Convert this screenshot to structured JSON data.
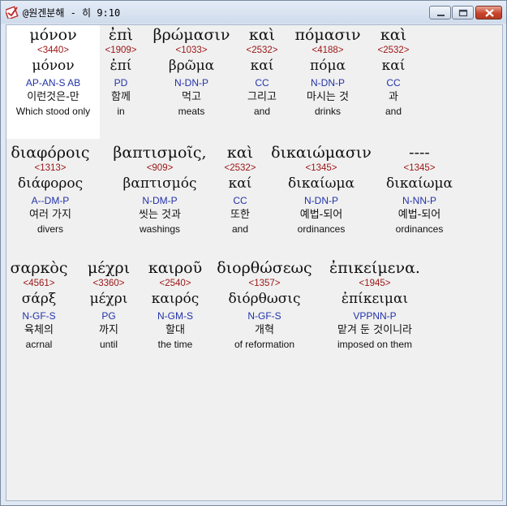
{
  "window": {
    "title": "@원겐분해 - 히 9:10"
  },
  "lines": [
    {
      "words": [
        {
          "greek": "μόνον",
          "strong": "<3440>",
          "lemma": "μόνον",
          "parse": "AP-AN-S AB",
          "korean": "이런것은-만",
          "english": "Which stood only",
          "selected": true
        },
        {
          "greek": "ἐπὶ",
          "strong": "<1909>",
          "lemma": "ἐπί",
          "parse": "PD",
          "korean": "함께",
          "english": "in"
        },
        {
          "greek": "βρώμασιν",
          "strong": "<1033>",
          "lemma": "βρῶμα",
          "parse": "N-DN-P",
          "korean": "먹고",
          "english": "meats"
        },
        {
          "greek": "καὶ",
          "strong": "<2532>",
          "lemma": "καί",
          "parse": "CC",
          "korean": "그리고",
          "english": "and"
        },
        {
          "greek": "πόμασιν",
          "strong": "<4188>",
          "lemma": "πόμα",
          "parse": "N-DN-P",
          "korean": "마시는 것",
          "english": "drinks"
        },
        {
          "greek": "καὶ",
          "strong": "<2532>",
          "lemma": "καί",
          "parse": "CC",
          "korean": "과",
          "english": "and"
        }
      ]
    },
    {
      "words": [
        {
          "greek": "διαφόροις",
          "strong": "<1313>",
          "lemma": "διάφορος",
          "parse": "A--DM-P",
          "korean": "여러 가지",
          "english": "divers"
        },
        {
          "greek": "βαπτισμοῖς,",
          "strong": "<909>",
          "lemma": "βαπτισμός",
          "parse": "N-DM-P",
          "korean": "씻는 것과",
          "english": "washings"
        },
        {
          "greek": "καὶ",
          "strong": "<2532>",
          "lemma": "καί",
          "parse": "CC",
          "korean": "또한",
          "english": "and"
        },
        {
          "greek": "δικαιώμασιν",
          "strong": "<1345>",
          "lemma": "δικαίωμα",
          "parse": "N-DN-P",
          "korean": "예법-되어",
          "english": "ordinances"
        },
        {
          "greek": "----",
          "strong": "<1345>",
          "lemma": "δικαίωμα",
          "parse": "N-NN-P",
          "korean": "예법-되어",
          "english": "ordinances"
        }
      ]
    },
    {
      "words": [
        {
          "greek": "σαρκὸς",
          "strong": "<4561>",
          "lemma": "σάρξ",
          "parse": "N-GF-S",
          "korean": "육체의",
          "english": "acrnal"
        },
        {
          "greek": "μέχρι",
          "strong": "<3360>",
          "lemma": "μέχρι",
          "parse": "PG",
          "korean": "까지",
          "english": "until"
        },
        {
          "greek": "καιροῦ",
          "strong": "<2540>",
          "lemma": "καιρός",
          "parse": "N-GM-S",
          "korean": "할대",
          "english": "the time"
        },
        {
          "greek": "διορθώσεως",
          "strong": "<1357>",
          "lemma": "διόρθωσις",
          "parse": "N-GF-S",
          "korean": "개혁",
          "english": "of reformation"
        },
        {
          "greek": "ἐπικείμενα.",
          "strong": "<1945>",
          "lemma": "ἐπίκειμαι",
          "parse": "VPPNN-P",
          "korean": "맡겨 둔 것이니라",
          "english": "imposed on them"
        }
      ]
    }
  ]
}
